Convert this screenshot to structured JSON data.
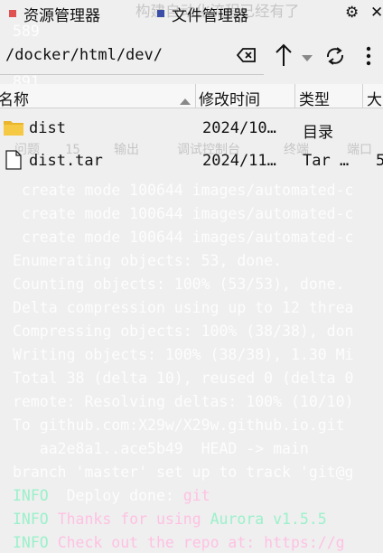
{
  "tabs": [
    {
      "label": "资源管理器"
    },
    {
      "label": "文件管理器"
    }
  ],
  "path": "/docker/html/dev/",
  "columns": [
    "名称",
    "修改时间",
    "类型",
    "大"
  ],
  "rows": [
    {
      "name": "dist",
      "modified": "2024/10…",
      "type": "目录",
      "size": ""
    },
    {
      "name": "dist.tar",
      "modified": "2024/11…",
      "type": "Tar …",
      "size": "5"
    }
  ],
  "terminal": {
    "ghost_top": "构建自动化流程已经有了",
    "ghost_589": "589",
    "ghost_891": "891",
    "ghost_tabs": [
      "问题",
      "15",
      "输出",
      "调试控制台",
      "终端",
      "端口"
    ],
    "lines": [
      " create mode 100644 images/automated-c",
      " create mode 100644 images/automated-c",
      " create mode 100644 images/automated-c",
      "Enumerating objects: 53, done.",
      "Counting objects: 100% (53/53), done.",
      "Delta compression using up to 12 threa",
      "Compressing objects: 100% (38/38), don",
      "Writing objects: 100% (38/38), 1.30 Mi",
      "Total 38 (delta 10), reused 0 (delta 0",
      "remote: Resolving deltas: 100% (10/10)",
      "To github.com:X29w/X29w.github.io.git",
      "   aa2e8a1..ace5b49  HEAD -> main",
      "branch 'master' set up to track 'git@g"
    ],
    "info1_tag": "INFO",
    "info1_text": "Deploy done:",
    "info1_val": "git",
    "info2_tag": "INFO",
    "info2_text": "Thanks for using",
    "info2_val": "Aurora v1.5.5",
    "info3_tag": "INFO",
    "info3_text": "Check out the repo at: https://g"
  }
}
